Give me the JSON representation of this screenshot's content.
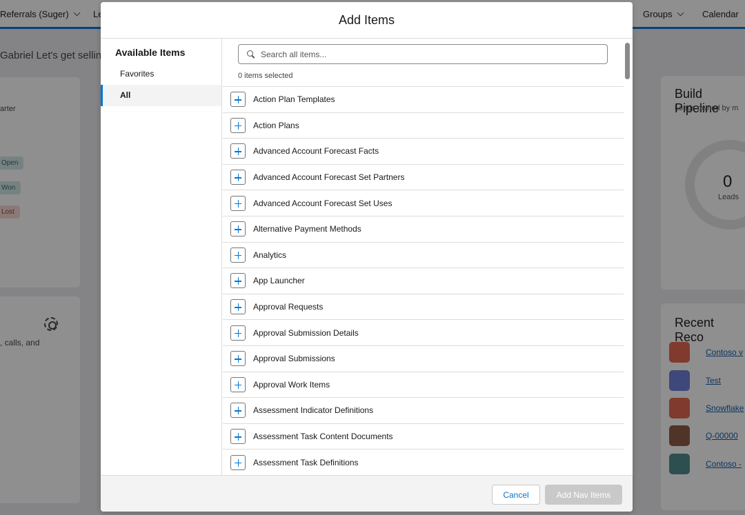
{
  "background": {
    "nav_items": [
      "Referrals (Suger)",
      "Le",
      "Groups",
      "Calendar"
    ],
    "greeting": "Gabriel  Let's get selling",
    "left_card": {
      "text1": "arter",
      "pills": [
        "Open",
        "Won",
        "Lost"
      ],
      "text2": ", calls, and"
    },
    "pipeline": {
      "title": "Build Pipeline",
      "subtitle": "Leads owned by m",
      "count": "0",
      "count_label": "Leads"
    },
    "recent": {
      "title": "Recent Reco",
      "items": [
        "Contoso v",
        "Test",
        "Snowflake",
        "Q-00000",
        "Contoso -"
      ]
    }
  },
  "modal": {
    "title": "Add Items",
    "sidebar": {
      "title": "Available Items",
      "items": [
        {
          "label": "Favorites"
        },
        {
          "label": "All"
        }
      ],
      "active": "All"
    },
    "search": {
      "placeholder": "Search all items..."
    },
    "selected_count": "0 items selected",
    "items": [
      "Action Plan Templates",
      "Action Plans",
      "Advanced Account Forecast Facts",
      "Advanced Account Forecast Set Partners",
      "Advanced Account Forecast Set Uses",
      "Alternative Payment Methods",
      "Analytics",
      "App Launcher",
      "Approval Requests",
      "Approval Submission Details",
      "Approval Submissions",
      "Approval Work Items",
      "Assessment Indicator Definitions",
      "Assessment Task Content Documents",
      "Assessment Task Definitions"
    ],
    "footer": {
      "cancel_label": "Cancel",
      "add_label": "Add Nav Items"
    }
  },
  "colors": {
    "brand": "#0176d3",
    "overlay": "#080707",
    "disabled_button": "#c9c9c9",
    "pill_open": "#cfe6e6",
    "pill_won": "#cfe6e6",
    "pill_lost": "#f5d7d3",
    "recent_icons": [
      "#e4654f",
      "#6b7ed9",
      "#e4654f",
      "#8a5a44",
      "#4b8a8a"
    ]
  },
  "icons": {
    "search": "search-icon",
    "add": "add-icon",
    "gear": "gear-icon",
    "chevron": "chevron-down-icon"
  }
}
